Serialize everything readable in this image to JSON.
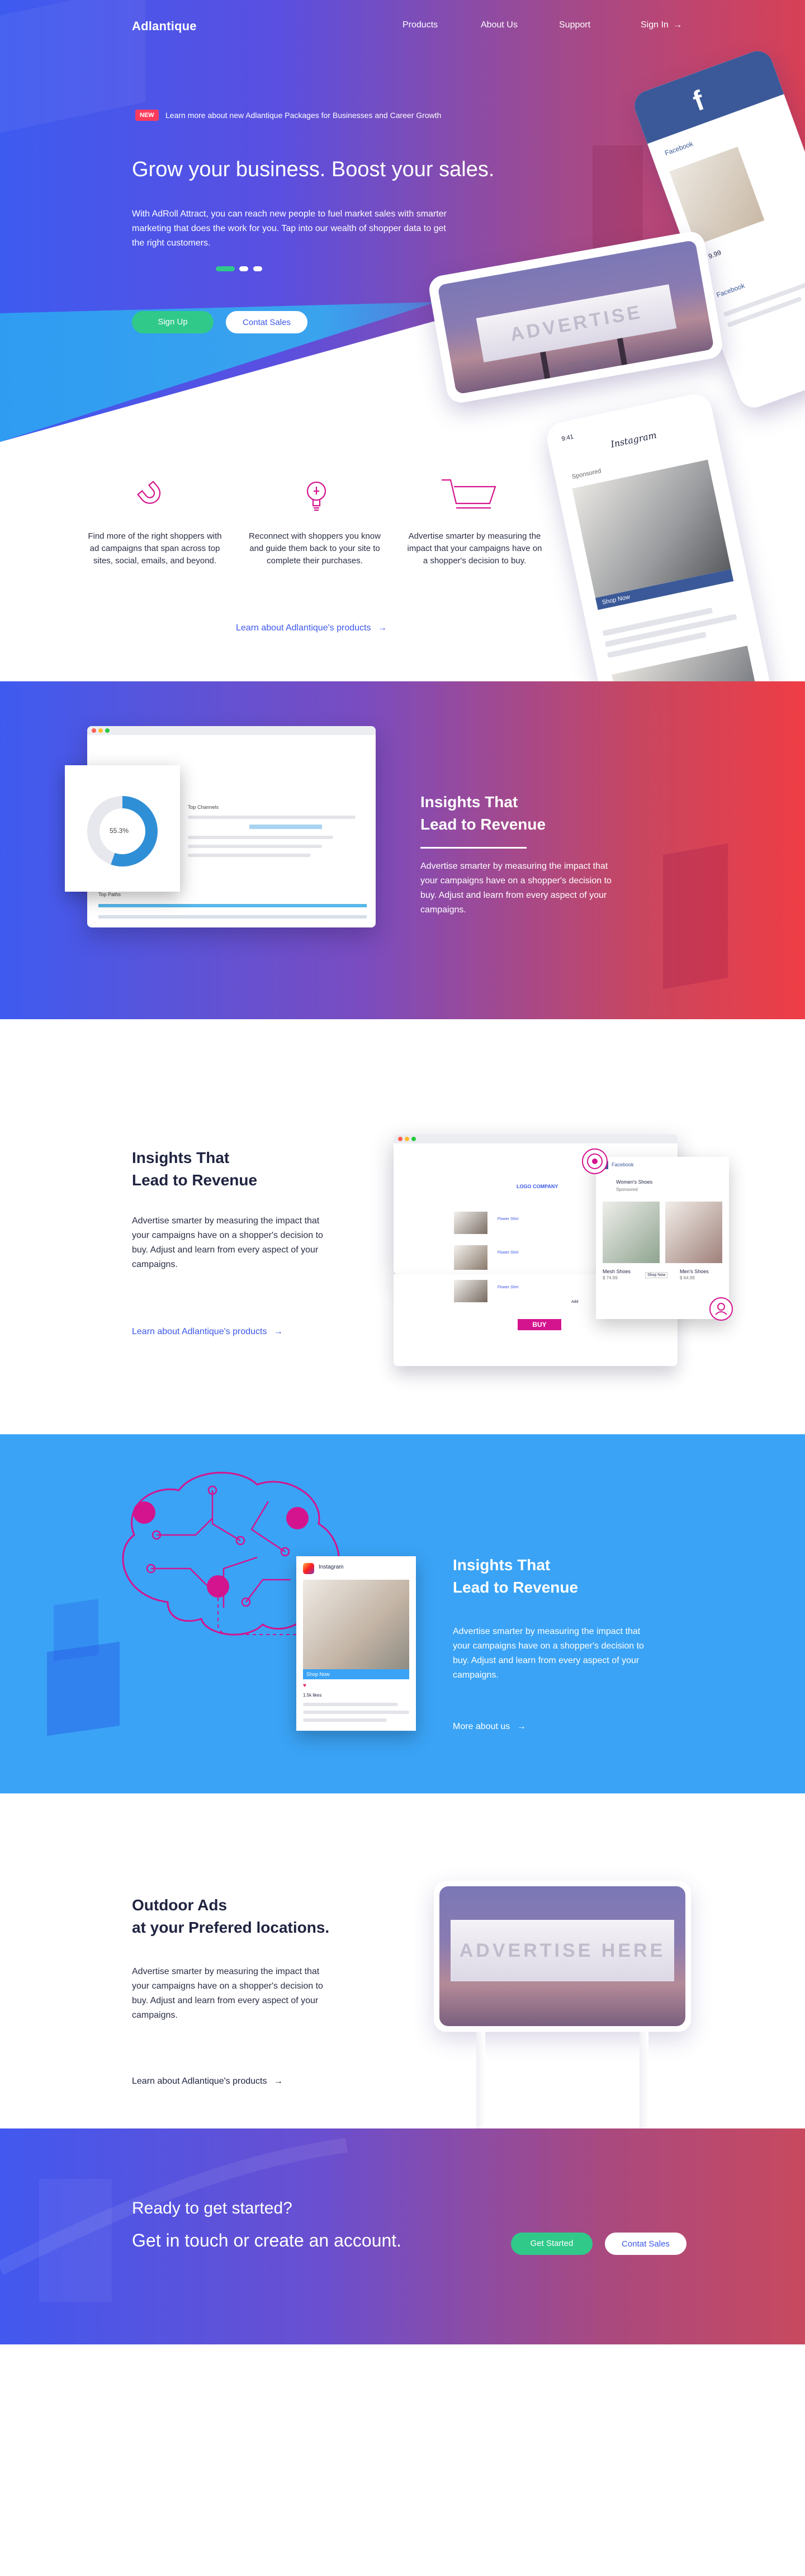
{
  "nav": {
    "logo": "Adlantique",
    "items": [
      "Products",
      "About Us",
      "Support"
    ],
    "signin": "Sign In"
  },
  "hero": {
    "badge": "NEW",
    "announcement": "Learn more about new Adlantique Packages for Businesses and Career Growth",
    "title": "Grow your business.  Boost your sales.",
    "body": "With AdRoll Attract, you can reach new people to fuel market sales with smarter marketing that does the work for you. Tap into our wealth of shopper data to get the right customers.",
    "signup": "Sign Up",
    "contact": "Contat Sales",
    "billboard": "ADVERTISE HERE"
  },
  "mock": {
    "facebook": "Facebook",
    "instagram": "Instagram",
    "time": "9:41",
    "sponsored": "Sponsored",
    "shop_now": "Shop Now",
    "price": "$ 9.99"
  },
  "features": [
    {
      "icon": "magnet-icon",
      "text": "Find more of the right shoppers with ad campaigns that span across top sites, social, emails, and beyond."
    },
    {
      "icon": "lightbulb-icon",
      "text": "Reconnect with shoppers you know and guide them back to your site to complete their purchases."
    },
    {
      "icon": "cart-icon",
      "text": "Advertise smarter by measuring the impact that your campaigns have on a shopper's decision to buy."
    }
  ],
  "features_link": "Learn about Adlantique's products",
  "sec2": {
    "title_line1": "Insights That",
    "title_line2": "Lead to Revenue",
    "body": "Advertise smarter by measuring the impact that your campaigns have on a shopper's decision to buy. Adjust and learn from every aspect of your campaigns.",
    "donut_value": "55.3%",
    "top_channels": "Top Channels",
    "top_paths": "Top Paths"
  },
  "sec3": {
    "title_line1": "Insights That",
    "title_line2": "Lead to Revenue",
    "body": "Advertise smarter by measuring the impact that your campaigns have on a shopper's decision to buy. Adjust and learn from every aspect of your campaigns.",
    "link": "Learn about Adlantique's products",
    "logo_company": "LOGO COMPANY",
    "buy": "BUY",
    "facebook": "Facebook",
    "womens_shoes": "Women's Shoes",
    "sponsored": "Sponsored",
    "mesh_shoes": "Mesh Shoes",
    "mesh_price": "$ 74.99",
    "mens_shoes": "Men's Shoes",
    "mens_price": "$ 64.99",
    "shop_now": "Shop Now",
    "flower_shirt": "Flower Shirt",
    "add": "Add"
  },
  "sec4": {
    "title_line1": "Insights That",
    "title_line2": "Lead to Revenue",
    "body": "Advertise smarter by measuring the impact that your campaigns have on a shopper's decision to buy. Adjust and learn from every aspect of your campaigns.",
    "link": "More about us",
    "instagram": "Instagram",
    "shop_now": "Shop Now",
    "likes": "1.5k likes"
  },
  "sec5": {
    "title_line1": "Outdoor Ads",
    "title_line2": "at your Prefered locations.",
    "body": "Advertise smarter by measuring the impact that your campaigns have on a shopper's decision to buy. Adjust and learn from every aspect of your campaigns.",
    "link": "Learn about Adlantique's products",
    "billboard": "ADVERTISE HERE"
  },
  "cta": {
    "line1": "Ready to get started?",
    "line2": "Get in touch or create an account.",
    "get_started": "Get Started",
    "contact": "Contat Sales"
  },
  "colors": {
    "accent": "#3c58e8",
    "green": "#30c98a",
    "magenta": "#d4148f",
    "cyan": "#3aa3f5"
  }
}
